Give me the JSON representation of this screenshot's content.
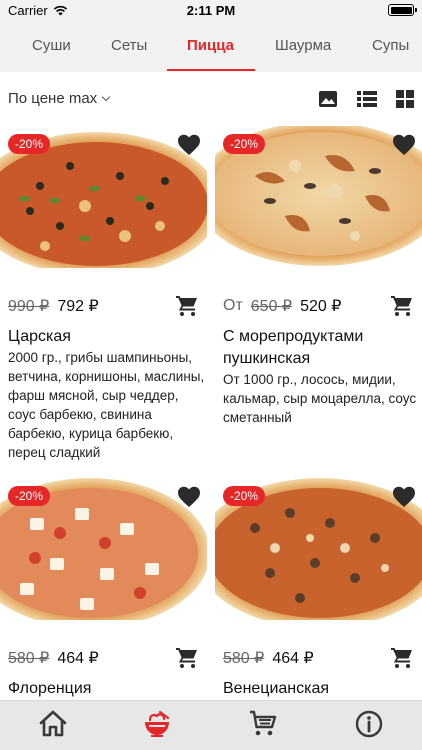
{
  "status": {
    "carrier": "Carrier",
    "time": "2:11 PM"
  },
  "categories": [
    {
      "label": "Суши",
      "active": false
    },
    {
      "label": "Сеты",
      "active": false
    },
    {
      "label": "Пицца",
      "active": true
    },
    {
      "label": "Шаурма",
      "active": false
    },
    {
      "label": "Супы",
      "active": false
    }
  ],
  "toolbar": {
    "sort_label": "По цене max"
  },
  "products": [
    {
      "discount": "-20%",
      "price_prefix": "",
      "old_price": "990 ₽",
      "price": "792 ₽",
      "name": "Царская",
      "weight": "2000 гр.,",
      "ingredients": "грибы шампиньоны, ветчина, корнишоны, маслины, фарш мясной, сыр чеддер, соус барбекю, свинина барбекю, курица барбекю, перец сладкий"
    },
    {
      "discount": "-20%",
      "price_prefix": "От",
      "old_price": "650 ₽",
      "price": "520 ₽",
      "name": "С морепродуктами пушкинская",
      "weight": "От 1000 гр.,",
      "ingredients": "лосось, мидии, кальмар, сыр моцарелла, соус сметанный"
    },
    {
      "discount": "-20%",
      "price_prefix": "",
      "old_price": "580 ₽",
      "price": "464 ₽",
      "name": "Флоренция",
      "weight": "",
      "ingredients": ""
    },
    {
      "discount": "-20%",
      "price_prefix": "",
      "old_price": "580 ₽",
      "price": "464 ₽",
      "name": "Венецианская",
      "weight": "",
      "ingredients": ""
    }
  ],
  "tabbar": [
    {
      "icon": "home-icon",
      "active": false
    },
    {
      "icon": "food-bowl-icon",
      "active": true
    },
    {
      "icon": "cart-icon",
      "active": false
    },
    {
      "icon": "info-icon",
      "active": false
    }
  ],
  "colors": {
    "accent": "#e52727",
    "bar_bg": "#f2f2f2",
    "tab_bg": "#e7e7e7"
  }
}
